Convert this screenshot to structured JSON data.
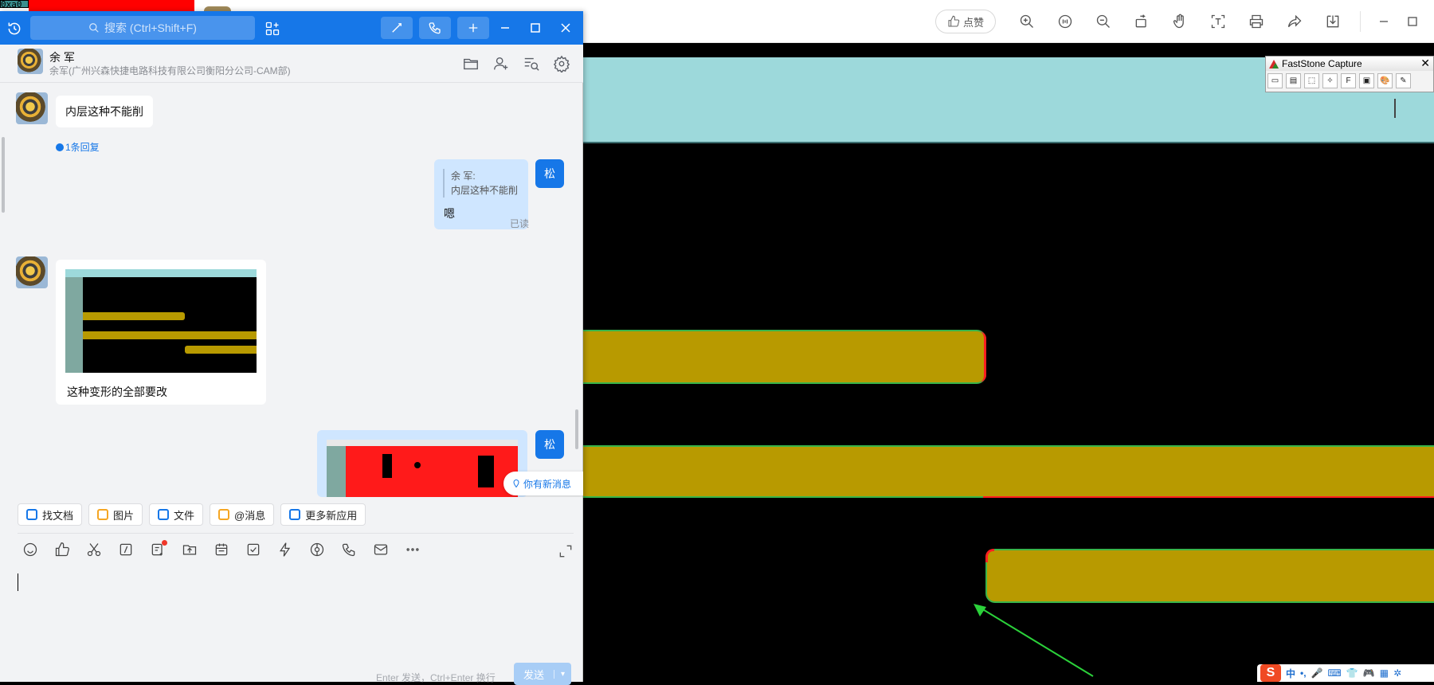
{
  "viewer": {
    "corner_tag": "0xa0",
    "like_label": "点赞",
    "toolbar_icons": [
      "zoom-in-icon",
      "fit-icon",
      "zoom-out-icon",
      "rotate-icon",
      "hand-icon",
      "ocr-icon",
      "print-icon",
      "share-icon",
      "download-icon"
    ],
    "fsc_title": "FastStone Capture",
    "fsc_close": "✕",
    "fsc_tools": [
      "▭",
      "▤",
      "⬚",
      "✧",
      "F",
      "▣",
      "🎨",
      "✎"
    ],
    "ime": {
      "logo": "S",
      "mode": "中",
      "items": [
        "•,",
        "🎤",
        "⌨",
        "👕",
        "🎮",
        "▦",
        "✲"
      ]
    }
  },
  "chat": {
    "search_placeholder": "搜索 (Ctrl+Shift+F)",
    "accent": "#1677e8",
    "contact_name": "余  军",
    "contact_org": "余军(广州兴森快捷电路科技有限公司衡阳分公司-CAM部)",
    "messages": [
      {
        "from": "other",
        "type": "text",
        "text": "内层这种不能削",
        "replies": "1条回复"
      },
      {
        "from": "self",
        "type": "quote",
        "quote_author": "余  军:",
        "quote_text": "内层这种不能削",
        "text": "嗯",
        "status": "已读",
        "avatar_text": "松"
      },
      {
        "from": "other",
        "type": "image",
        "caption": "这种变形的全部要改"
      },
      {
        "from": "self",
        "type": "image",
        "avatar_text": "松"
      }
    ],
    "new_message_tip": "你有新消息",
    "quick_actions": [
      "找文档",
      "图片",
      "文件",
      "@消息",
      "更多新应用"
    ],
    "quick_action_colors": [
      "#1677e8",
      "#f5a623",
      "#1677e8",
      "#f5a623",
      "#1677e8"
    ],
    "input_tools": [
      "emoji-icon",
      "thumb-icon",
      "scissors-icon",
      "slash-icon",
      "note-icon",
      "upload-icon",
      "calendar-icon",
      "task-icon",
      "lightning-icon",
      "screen-share-icon",
      "phone-icon",
      "mail-icon",
      "more-icon"
    ],
    "send_hint": "Enter 发送，Ctrl+Enter 换行",
    "send_label": "发送",
    "send_dropdown": "▾"
  }
}
